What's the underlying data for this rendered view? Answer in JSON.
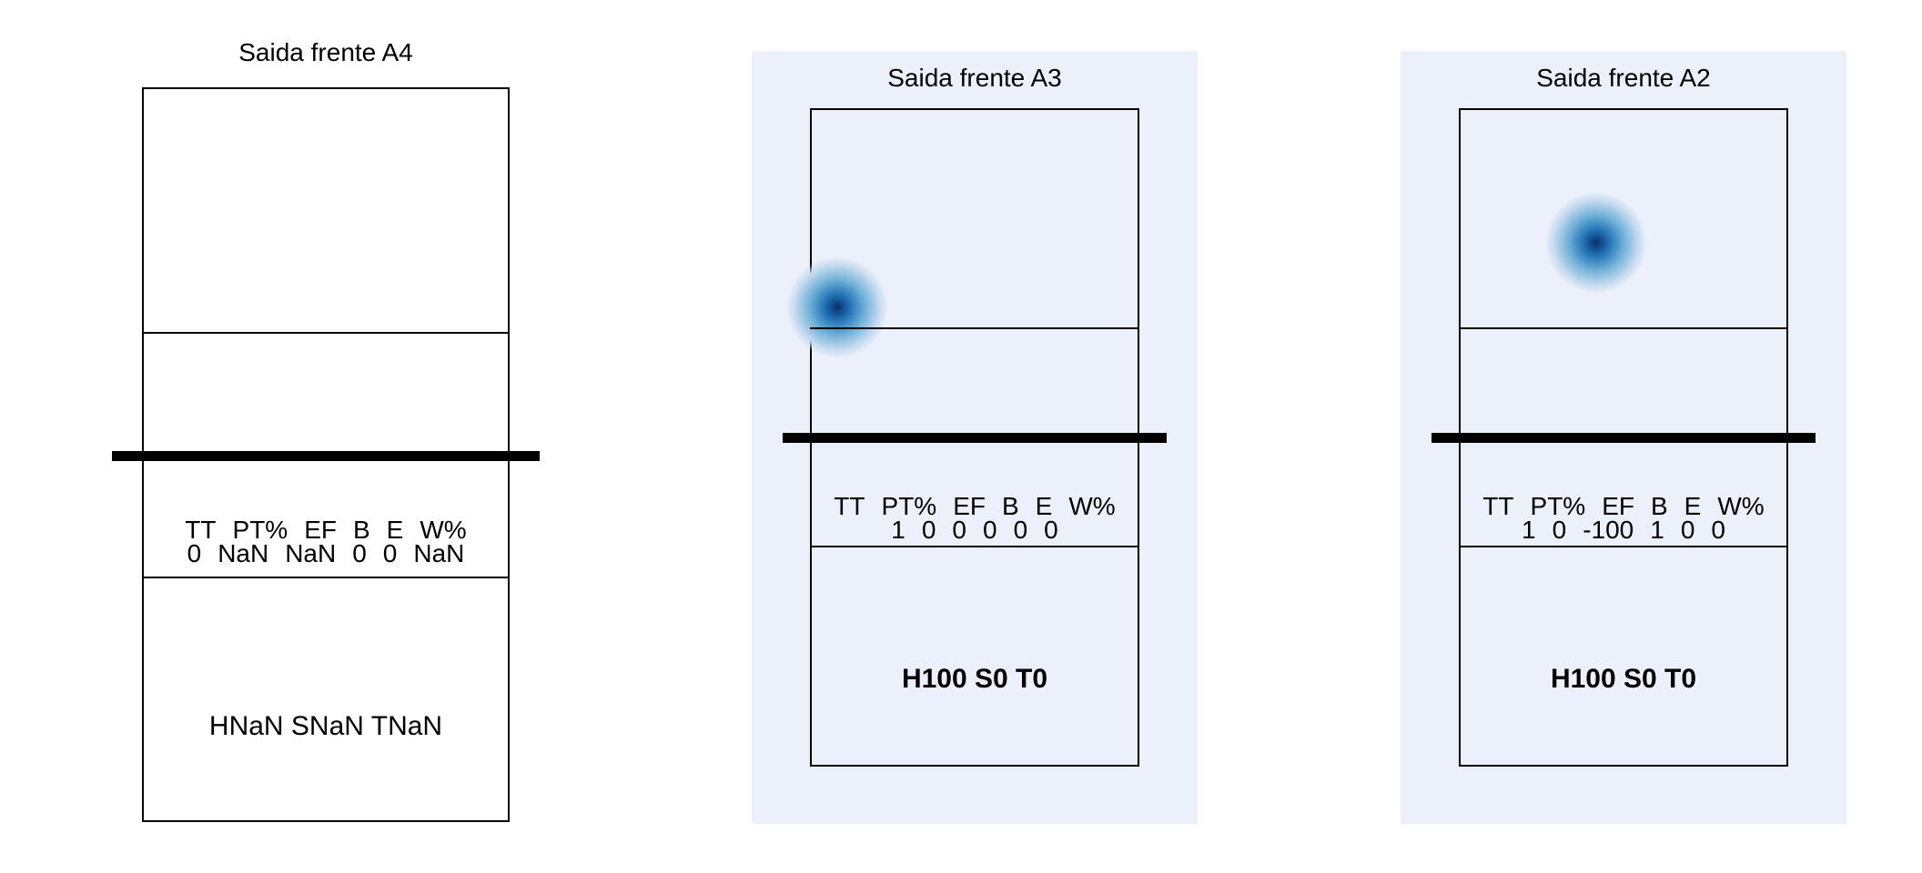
{
  "chart_data": [
    {
      "type": "heatmap",
      "title": "Saida frente A4",
      "stats_headers": [
        "TT",
        "PT%",
        "EF",
        "B",
        "E",
        "W%"
      ],
      "stats_values": [
        "0",
        "NaN",
        "NaN",
        "0",
        "0",
        "NaN"
      ],
      "summary": "HNaN SNaN TNaN",
      "highlighted_background": false,
      "hotspots": []
    },
    {
      "type": "heatmap",
      "title": "Saida frente A3",
      "stats_headers": [
        "TT",
        "PT%",
        "EF",
        "B",
        "E",
        "W%"
      ],
      "stats_values": [
        "1",
        "0",
        "0",
        "0",
        "0",
        "0"
      ],
      "summary": "H100 S0 T0",
      "highlighted_background": true,
      "hotspots": [
        {
          "x": 0.08,
          "y": 0.33,
          "intensity": 1
        }
      ]
    },
    {
      "type": "heatmap",
      "title": "Saida frente A2",
      "stats_headers": [
        "TT",
        "PT%",
        "EF",
        "B",
        "E",
        "W%"
      ],
      "stats_values": [
        "1",
        "0",
        "-100",
        "1",
        "0",
        "0"
      ],
      "summary": "H100 S0 T0",
      "highlighted_background": true,
      "hotspots": [
        {
          "x": 0.42,
          "y": 0.2,
          "intensity": 1
        }
      ]
    }
  ],
  "colors": {
    "panel_background": "#ebf0fb",
    "heat_core": "#08306b",
    "heat_mid": "#2171b5",
    "heat_edge": "#c6dbef"
  }
}
